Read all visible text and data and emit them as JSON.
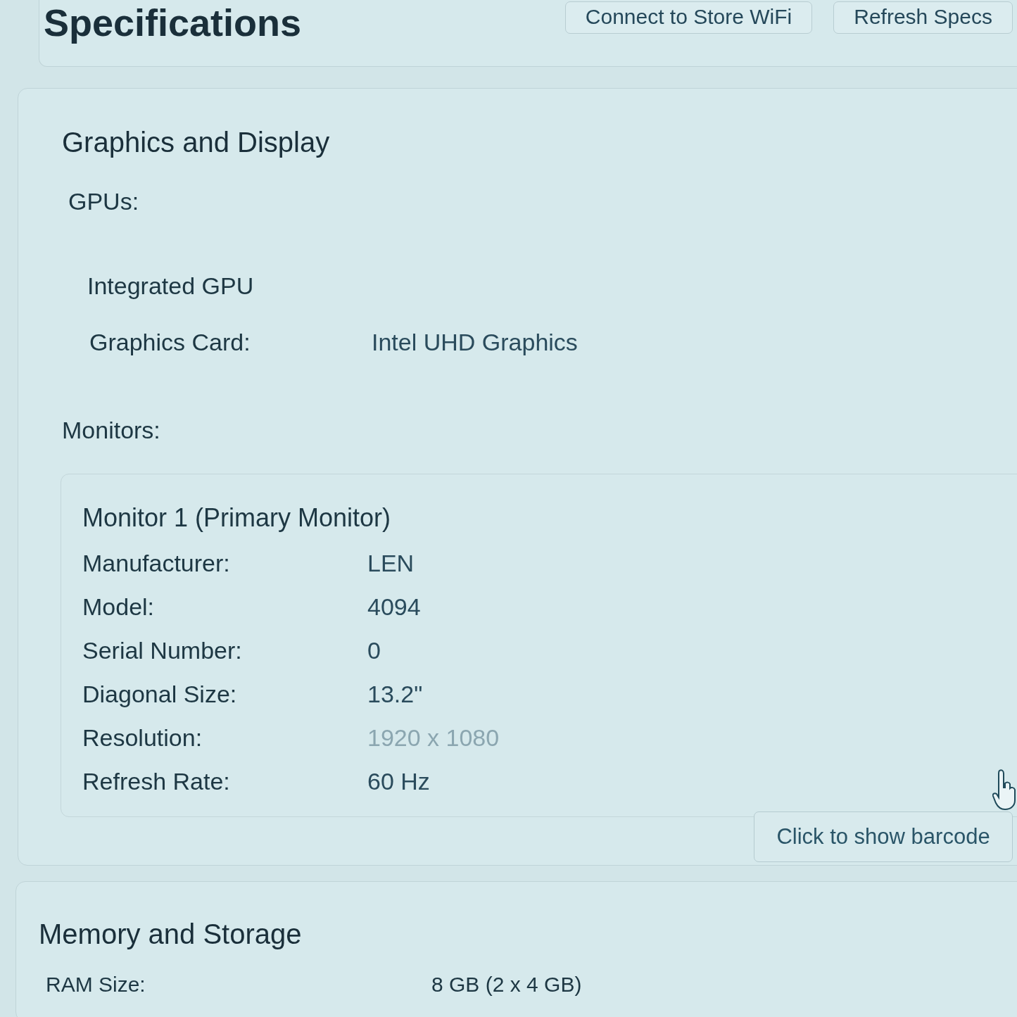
{
  "header": {
    "title": "Specifications",
    "buttons": [
      "Connect to Store WiFi",
      "Refresh Specs"
    ]
  },
  "graphics_and_display": {
    "title": "Graphics and Display",
    "gpus_label": "GPUs:",
    "gpus": [
      {
        "name": "Integrated GPU",
        "fields": [
          {
            "label": "Graphics Card:",
            "value": "Intel UHD Graphics"
          }
        ]
      }
    ],
    "monitors_label": "Monitors:",
    "monitors": [
      {
        "title": "Monitor 1 (Primary Monitor)",
        "fields": [
          {
            "label": "Manufacturer:",
            "value": "LEN",
            "dimmed": false
          },
          {
            "label": "Model:",
            "value": "4094",
            "dimmed": false
          },
          {
            "label": "Serial Number:",
            "value": "0",
            "dimmed": false
          },
          {
            "label": "Diagonal Size:",
            "value": "13.2\"",
            "dimmed": false
          },
          {
            "label": "Resolution:",
            "value": "1920 x 1080",
            "dimmed": true
          },
          {
            "label": "Refresh Rate:",
            "value": "60 Hz",
            "dimmed": false
          }
        ]
      }
    ],
    "barcode_button": "Click to show barcode"
  },
  "memory_and_storage": {
    "title": "Memory and Storage",
    "fields": [
      {
        "label": "RAM Size:",
        "value": "8 GB (2 x 4 GB)"
      }
    ]
  }
}
